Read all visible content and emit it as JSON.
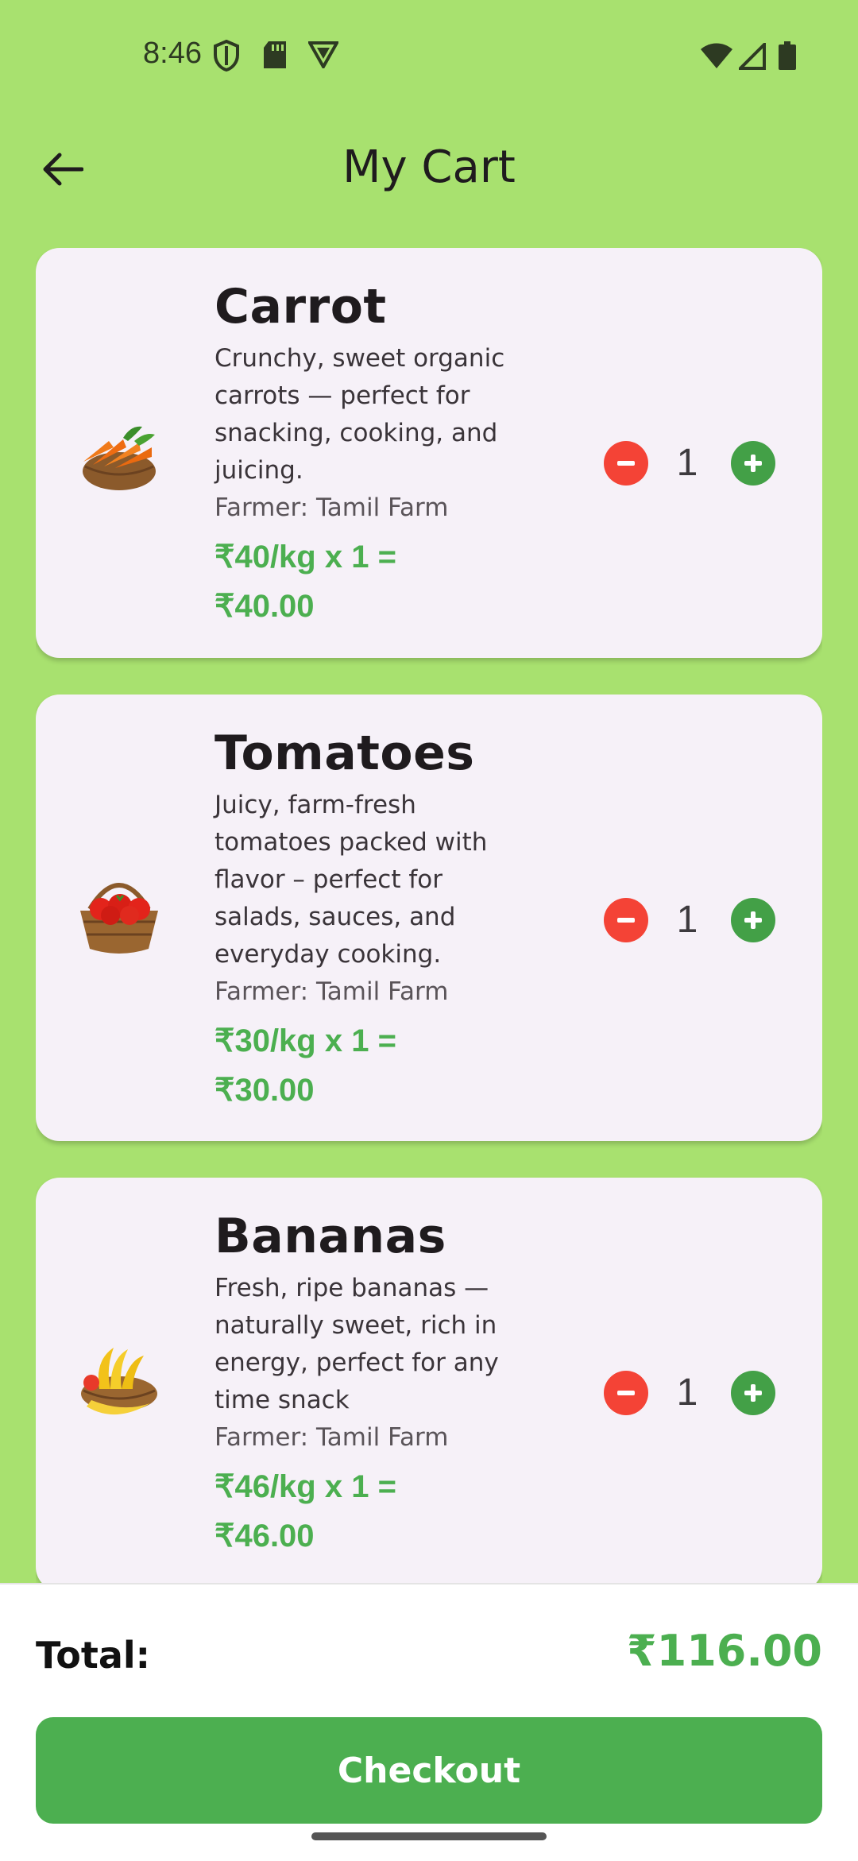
{
  "status_bar": {
    "time": "8:46"
  },
  "header": {
    "title": "My Cart"
  },
  "cart": {
    "items": [
      {
        "name": "Carrot",
        "description": "Crunchy, sweet organic carrots — perfect for snacking, cooking, and juicing.",
        "farmer": "Farmer: Tamil Farm",
        "price_line1": "₹40/kg x 1 =",
        "price_line2": "₹40.00",
        "quantity": "1",
        "image_icon": "carrot-basket-image"
      },
      {
        "name": "Tomatoes",
        "description": "Juicy, farm-fresh tomatoes packed with flavor – perfect for salads, sauces, and everyday cooking.",
        "farmer": "Farmer: Tamil Farm",
        "price_line1": "₹30/kg x 1 =",
        "price_line2": "₹30.00",
        "quantity": "1",
        "image_icon": "tomato-basket-image"
      },
      {
        "name": "Bananas",
        "description": "Fresh, ripe bananas — naturally sweet, rich in energy, perfect for any time snack",
        "farmer": "Farmer: Tamil Farm",
        "price_line1": "₹46/kg x 1 =",
        "price_line2": "₹46.00",
        "quantity": "1",
        "image_icon": "banana-basket-image"
      }
    ]
  },
  "summary": {
    "total_label": "Total:",
    "total_value": "₹116.00",
    "checkout_label": "Checkout"
  },
  "colors": {
    "background": "#a8e16f",
    "card": "#f6f1f8",
    "accent_green": "#4caf50",
    "minus_red": "#f44336"
  }
}
